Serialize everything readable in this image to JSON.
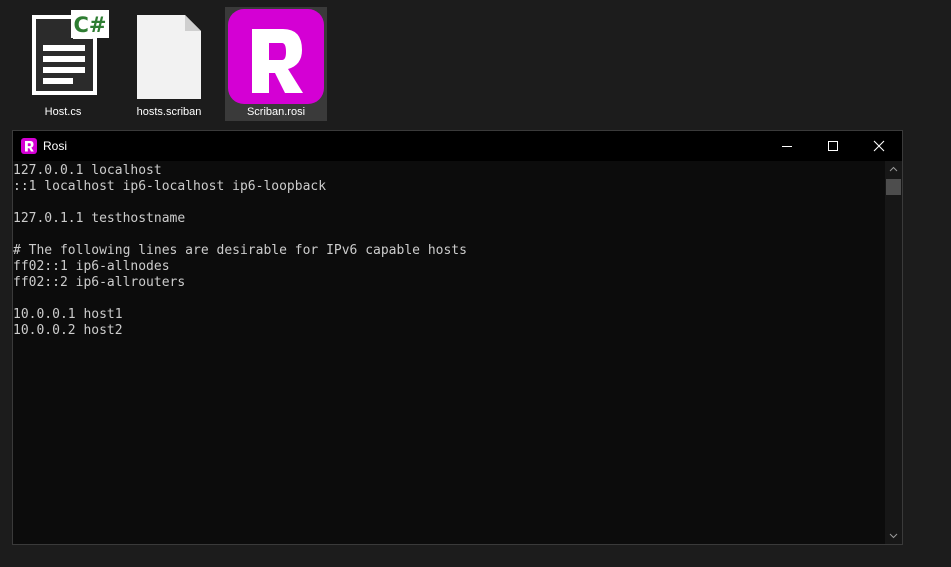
{
  "desktop": {
    "icons": [
      {
        "label": "Host.cs",
        "badge": "C#"
      },
      {
        "label": "hosts.scriban"
      },
      {
        "label": "Scriban.rosi",
        "glyph": "R"
      }
    ]
  },
  "window": {
    "title": "Rosi",
    "app_icon_glyph": "R",
    "controls": {
      "minimize": "minimize-icon",
      "maximize": "maximize-icon",
      "close": "close-icon"
    }
  },
  "terminal": {
    "lines": [
      "127.0.0.1 localhost",
      "::1 localhost ip6-localhost ip6-loopback",
      "",
      "127.0.1.1 testhostname",
      "",
      "# The following lines are desirable for IPv6 capable hosts",
      "ff02::1 ip6-allnodes",
      "ff02::2 ip6-allrouters",
      "",
      "10.0.0.1 host1",
      "10.0.0.2 host2"
    ]
  },
  "colors": {
    "desktop_bg": "#1c1c1c",
    "terminal_bg": "#0c0c0c",
    "terminal_text": "#cccccc",
    "rosi_magenta": "#d400d4",
    "csharp_green": "#2e7d32"
  }
}
